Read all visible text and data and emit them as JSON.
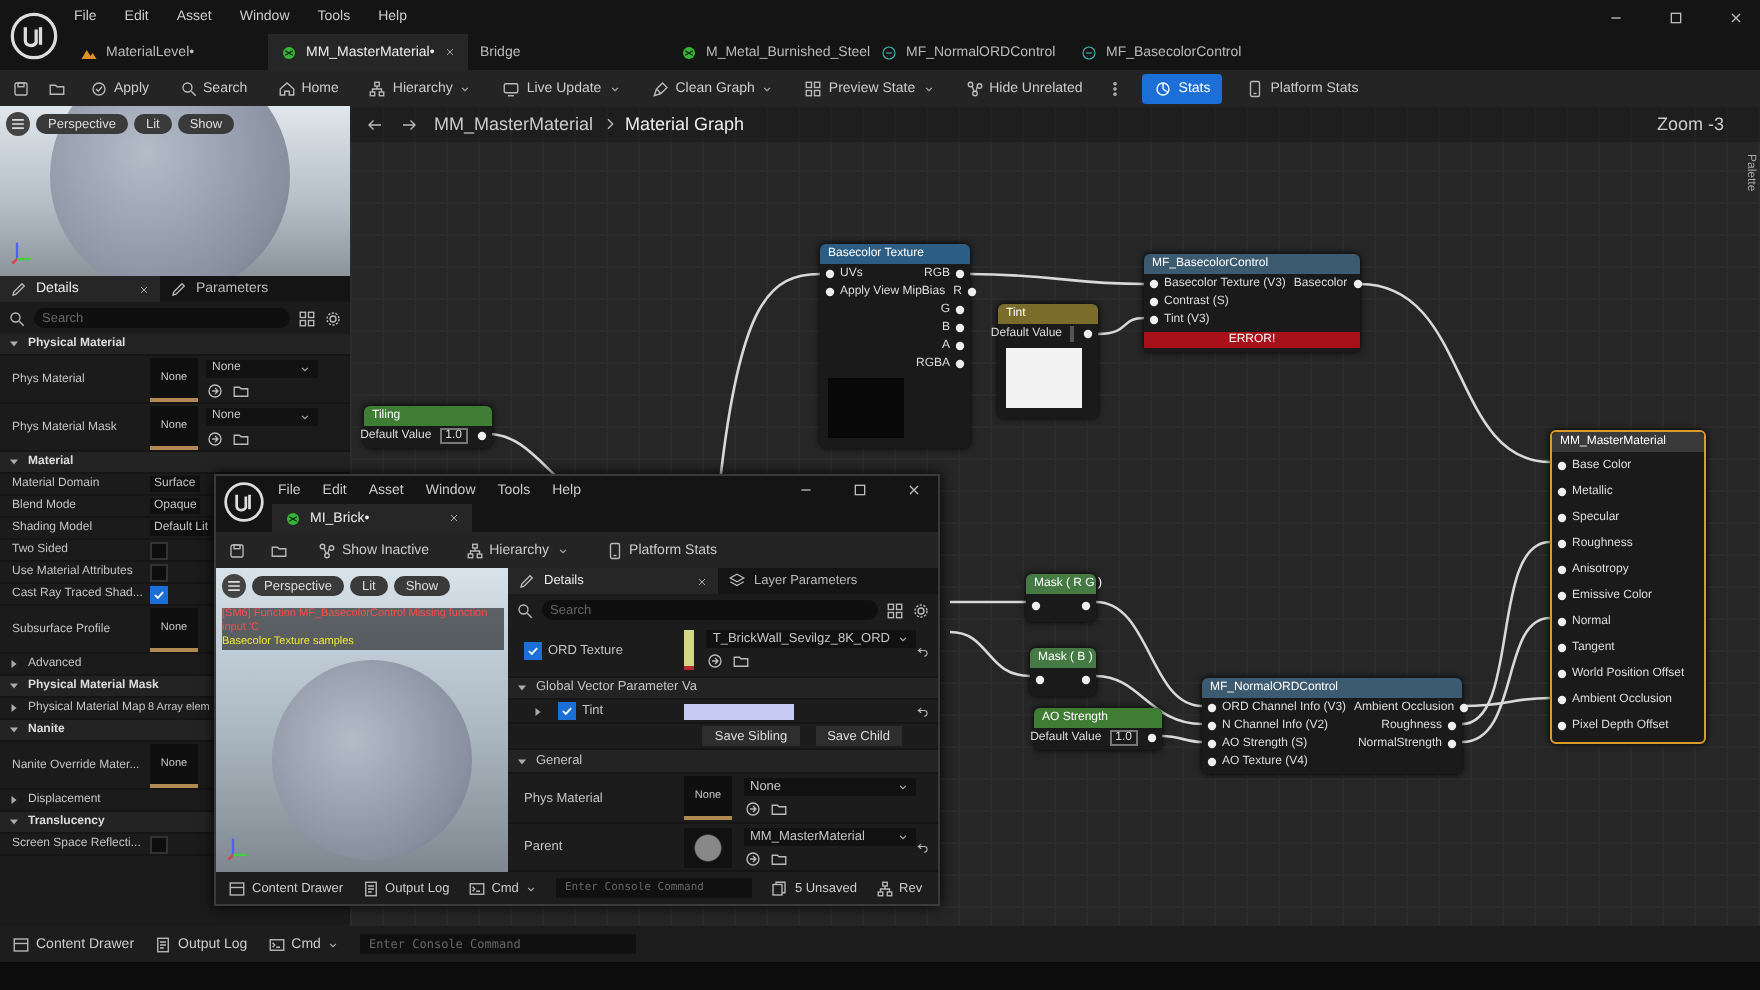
{
  "menu": [
    "File",
    "Edit",
    "Asset",
    "Window",
    "Tools",
    "Help"
  ],
  "tabs": [
    {
      "label": "MaterialLevel•",
      "kind": "level",
      "selected": false,
      "closable": false
    },
    {
      "label": "MM_MasterMaterial•",
      "kind": "material",
      "selected": true,
      "closable": true
    },
    {
      "label": "Bridge",
      "kind": "plain",
      "selected": false,
      "closable": false
    },
    {
      "label": "M_Metal_Burnished_Steel",
      "kind": "material",
      "selected": false,
      "closable": false
    },
    {
      "label": "MF_NormalORDControl",
      "kind": "function",
      "selected": false,
      "closable": false
    },
    {
      "label": "MF_BasecolorControl",
      "kind": "function",
      "selected": false,
      "closable": false
    }
  ],
  "toolbar": [
    {
      "kind": "button",
      "label": "Apply",
      "selected": false
    },
    {
      "kind": "button",
      "label": "Search",
      "selected": false
    },
    {
      "kind": "button",
      "label": "Home",
      "selected": false
    },
    {
      "kind": "menu",
      "label": "Hierarchy",
      "selected": false
    },
    {
      "kind": "menu",
      "label": "Live Update",
      "selected": false
    },
    {
      "kind": "menu",
      "label": "Clean Graph",
      "selected": false
    },
    {
      "kind": "menu",
      "label": "Preview State",
      "selected": false
    },
    {
      "kind": "button",
      "label": "Hide Unrelated",
      "selected": false
    },
    {
      "kind": "toggle",
      "label": "Stats",
      "selected": true
    },
    {
      "kind": "button",
      "label": "Platform Stats",
      "selected": false
    }
  ],
  "viewport": {
    "buttons": [
      "Perspective",
      "Lit",
      "Show"
    ]
  },
  "details": {
    "tabs": [
      {
        "label": "Details",
        "selected": true,
        "closable": true
      },
      {
        "label": "Parameters",
        "selected": false,
        "closable": false
      }
    ],
    "search_placeholder": "Search",
    "rows": [
      {
        "kind": "section",
        "label": "Physical Material",
        "expanded": true
      },
      {
        "kind": "asset",
        "label": "Phys Material",
        "thumb": "None",
        "dropdown": "None"
      },
      {
        "kind": "asset",
        "label": "Phys Material Mask",
        "thumb": "None",
        "dropdown": "None"
      },
      {
        "kind": "section",
        "label": "Material",
        "expanded": true
      },
      {
        "kind": "value",
        "label": "Material Domain",
        "value": "Surface"
      },
      {
        "kind": "value",
        "label": "Blend Mode",
        "value": "Opaque"
      },
      {
        "kind": "value",
        "label": "Shading Model",
        "value": "Default Lit"
      },
      {
        "kind": "check",
        "label": "Two Sided",
        "checked": false
      },
      {
        "kind": "check",
        "label": "Use Material Attributes",
        "checked": false
      },
      {
        "kind": "check",
        "label": "Cast Ray Traced Shad...",
        "checked": true
      },
      {
        "kind": "asset",
        "label": "Subsurface Profile",
        "thumb": "None"
      },
      {
        "kind": "group",
        "label": "Advanced",
        "expanded": false
      },
      {
        "kind": "section",
        "label": "Physical Material Mask",
        "expanded": true
      },
      {
        "kind": "group",
        "label": "Physical Material Map",
        "expanded": false,
        "value": "8 Array elem"
      },
      {
        "kind": "section",
        "label": "Nanite",
        "expanded": true
      },
      {
        "kind": "asset",
        "label": "Nanite Override Mater...",
        "thumb": "None"
      },
      {
        "kind": "group",
        "label": "Displacement",
        "expanded": false
      },
      {
        "kind": "section",
        "label": "Translucency",
        "expanded": true
      },
      {
        "kind": "check",
        "label": "Screen Space Reflecti...",
        "checked": false
      }
    ]
  },
  "graph": {
    "breadcrumb": [
      "MM_MasterMaterial",
      "Material Graph"
    ],
    "zoom": "Zoom -3",
    "palette": "Palette",
    "nodes": [
      {
        "kind": "scalar",
        "title": "Tiling",
        "default_label": "Default Value",
        "value": "1.0"
      },
      {
        "kind": "texture",
        "title": "Basecolor Texture",
        "inputs": [
          "UVs",
          "Apply View MipBias"
        ],
        "outputs": [
          "RGB",
          "R",
          "G",
          "B",
          "A",
          "RGBA"
        ]
      },
      {
        "kind": "vector",
        "title": "Tint",
        "default_label": "Default Value"
      },
      {
        "kind": "mask",
        "title": "Mask ( R G )"
      },
      {
        "kind": "mask",
        "title": "Mask ( B )"
      },
      {
        "kind": "scalar",
        "title": "AO Strength",
        "default_label": "Default Value",
        "value": "1.0"
      },
      {
        "kind": "function",
        "title": "MF_BasecolorControl",
        "inputs": [
          "Basecolor Texture (V3)",
          "Contrast (S)",
          "Tint (V3)"
        ],
        "outputs": [
          "Basecolor"
        ],
        "error": "ERROR!"
      },
      {
        "kind": "function",
        "title": "MF_NormalORDControl",
        "inputs": [
          "ORD Channel Info (V3)",
          "N Channel Info (V2)",
          "AO Strength (S)",
          "AO Texture (V4)"
        ],
        "outputs": [
          "Ambient Occlusion",
          "Roughness",
          "NormalStrength"
        ]
      },
      {
        "kind": "result",
        "title": "MM_MasterMaterial",
        "inputs": [
          "Base Color",
          "Metallic",
          "Specular",
          "Roughness",
          "Anisotropy",
          "Emissive Color",
          "Normal",
          "Tangent",
          "World Position Offset",
          "Ambient Occlusion",
          "Pixel Depth Offset"
        ]
      }
    ]
  },
  "status_bar": {
    "items": [
      "Content Drawer",
      "Output Log"
    ],
    "cmd": "Cmd",
    "console_placeholder": "Enter Console Command"
  },
  "instance_window": {
    "menu": [
      "File",
      "Edit",
      "Asset",
      "Window",
      "Tools",
      "Help"
    ],
    "tab": "MI_Brick•",
    "toolbar": [
      {
        "kind": "button",
        "label": "Show Inactive"
      },
      {
        "kind": "menu",
        "label": "Hierarchy"
      },
      {
        "kind": "button",
        "label": "Platform Stats"
      }
    ],
    "viewport": {
      "buttons": [
        "Perspective",
        "Lit",
        "Show"
      ],
      "messages": [
        {
          "kind": "error",
          "text": "[SM6] Function MF_BasecolorControl Missing function input 'C"
        },
        {
          "kind": "warning",
          "text": "Basecolor Texture samples"
        }
      ]
    },
    "details": {
      "tabs": [
        {
          "label": "Details",
          "selected": true,
          "closable": true
        },
        {
          "label": "Layer Parameters",
          "selected": false,
          "closable": false
        }
      ],
      "search_placeholder": "Search",
      "rows": [
        {
          "kind": "texture",
          "label": "ORD Texture",
          "checked": true,
          "color": "#d6d68a",
          "dropdown": "T_BrickWall_Sevilgz_8K_ORD"
        },
        {
          "kind": "section",
          "label": "Global Vector Parameter Va",
          "expanded": true
        },
        {
          "kind": "vector",
          "label": "Tint",
          "checked": true,
          "expanded": false,
          "color": "#c6cbf3"
        },
        {
          "kind": "buttons",
          "labels": [
            "Save Sibling",
            "Save Child"
          ]
        },
        {
          "kind": "section",
          "label": "General",
          "expanded": true
        },
        {
          "kind": "asset",
          "label": "Phys Material",
          "thumb": "None",
          "dropdown": "None"
        },
        {
          "kind": "parent",
          "label": "Parent",
          "dropdown": "MM_MasterMaterial"
        }
      ]
    },
    "status_bar": {
      "items": [
        "Content Drawer",
        "Output Log"
      ],
      "cmd": "Cmd",
      "console_placeholder": "Enter Console Command",
      "unsaved": "5 Unsaved",
      "revision": "Rev"
    }
  }
}
